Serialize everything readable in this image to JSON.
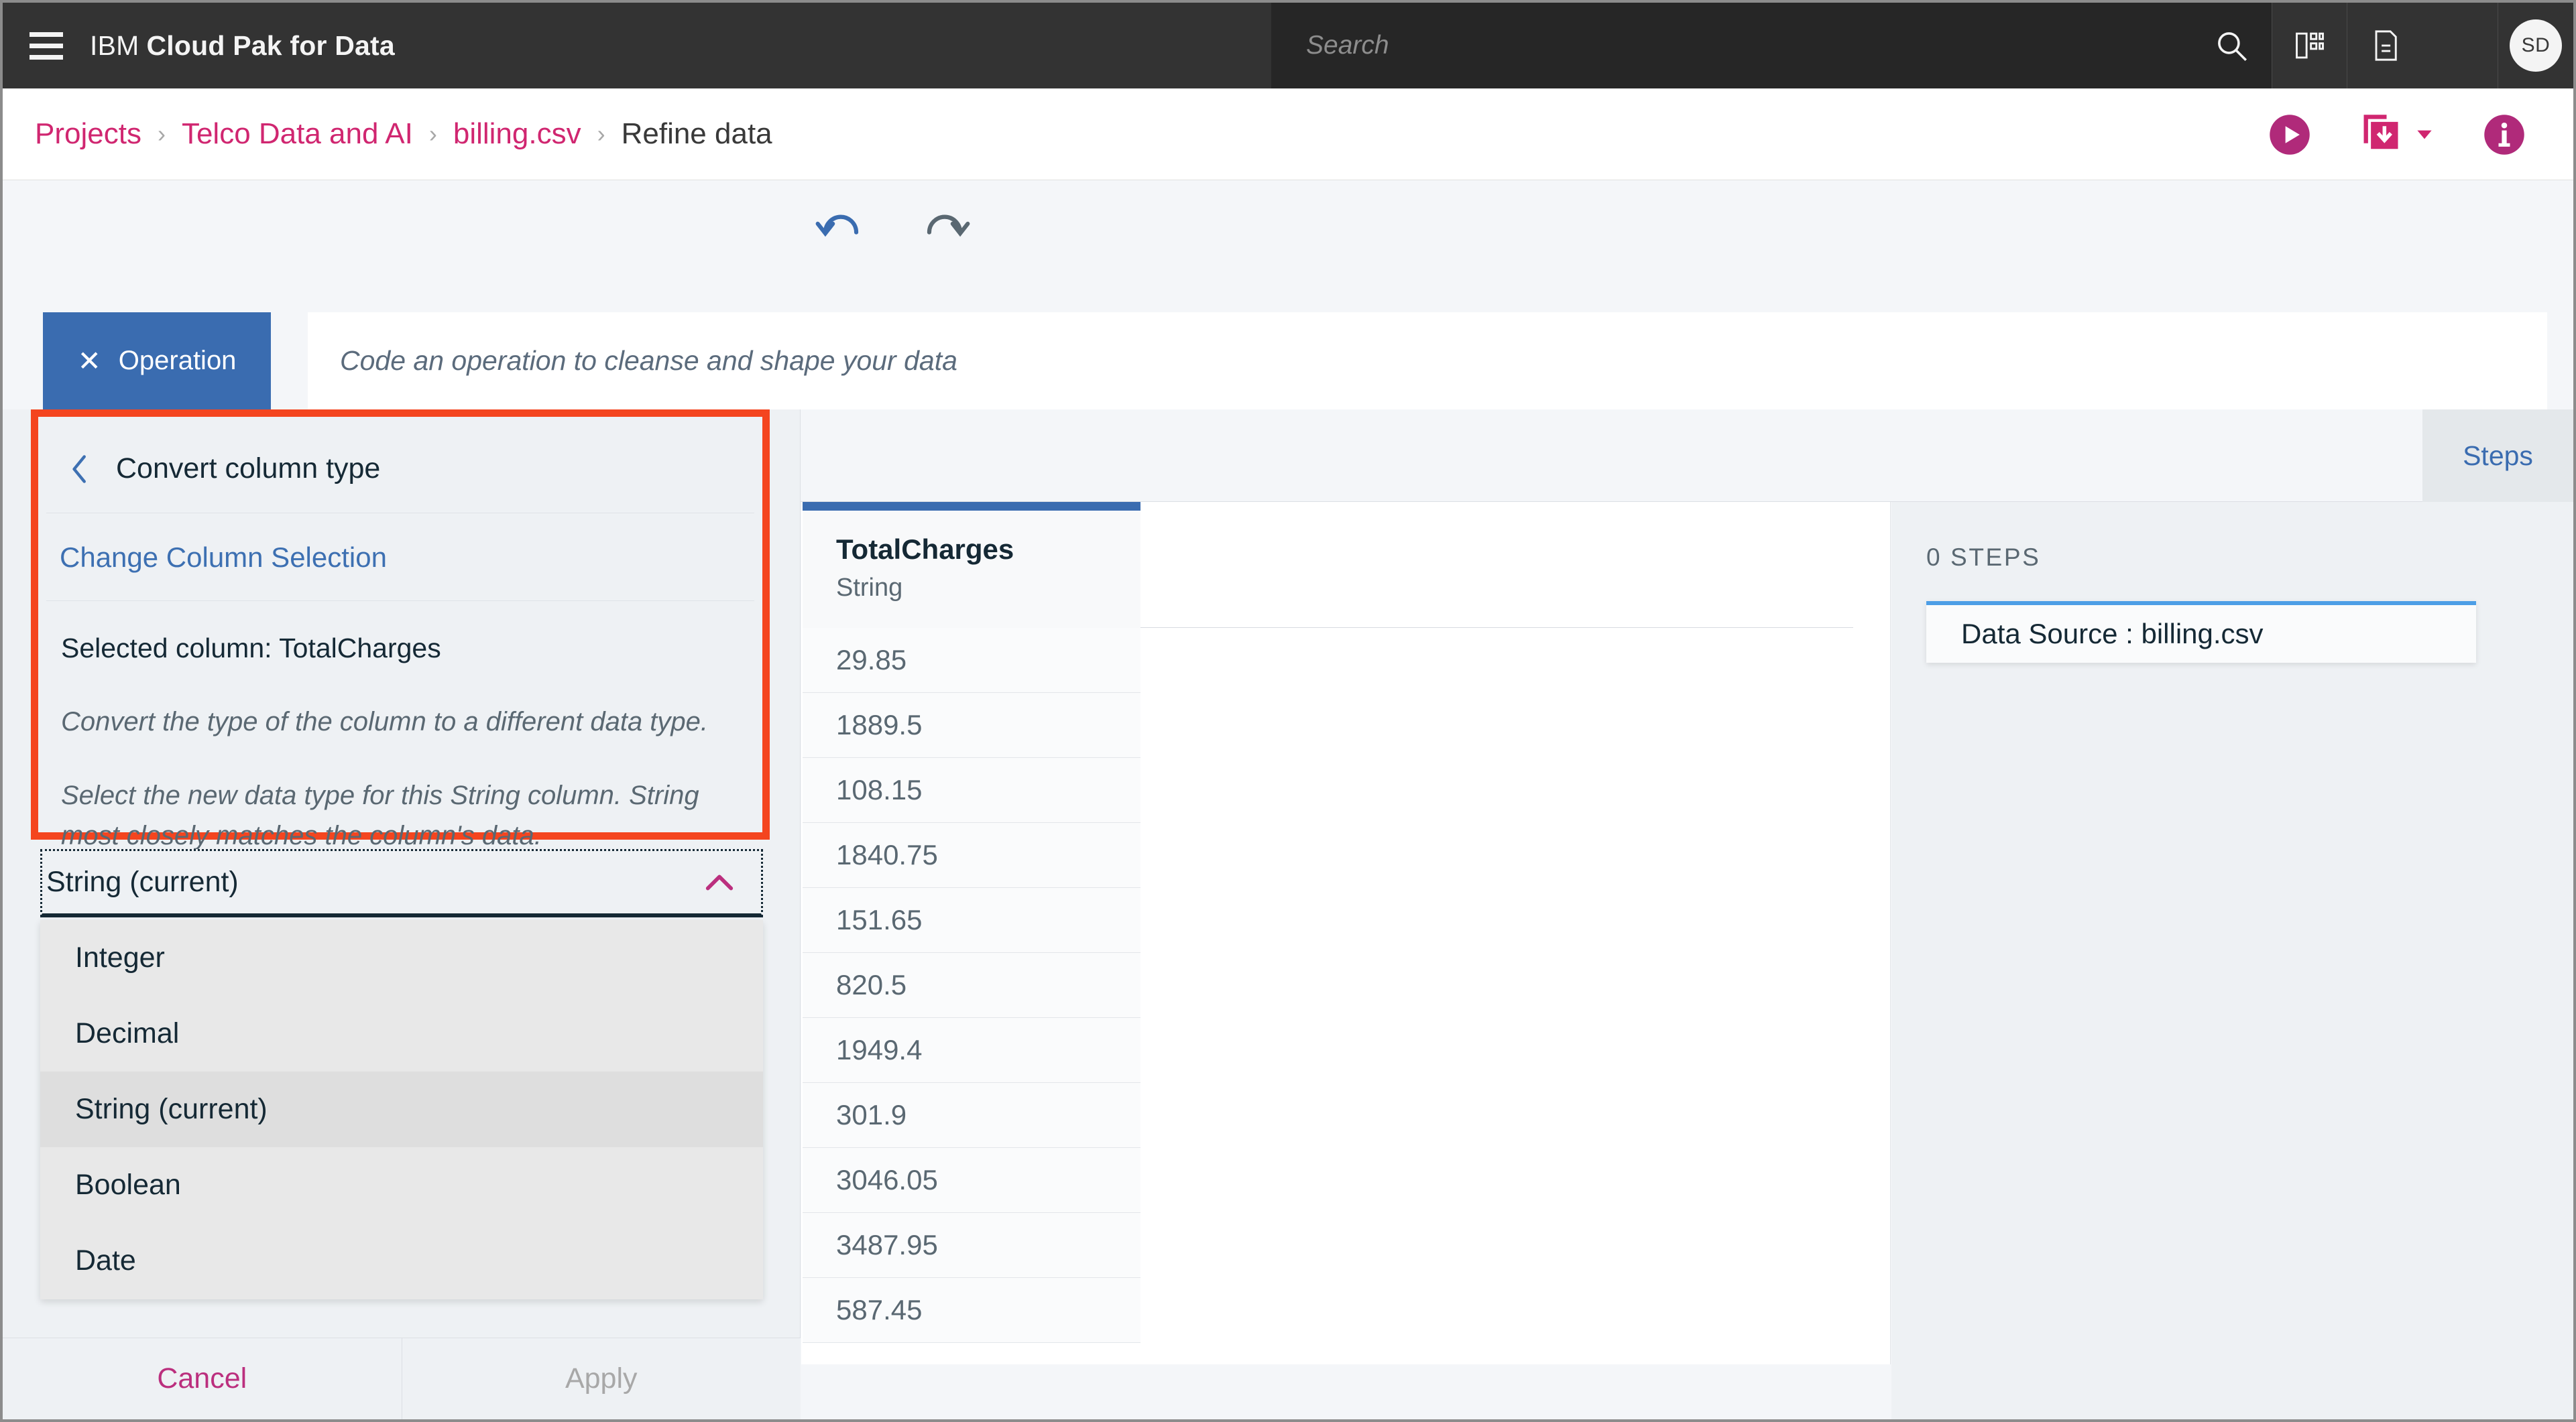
{
  "header": {
    "menu_icon": "hamburger-menu-icon",
    "brand_light": "IBM",
    "brand_bold": "Cloud Pak for Data",
    "search_placeholder": "Search",
    "search_value": "",
    "search_icon": "search-icon",
    "app_switcher_icon": "app-switcher-icon",
    "docs_icon": "document-icon",
    "avatar_initials": "SD"
  },
  "breadcrumb": {
    "items": [
      {
        "label": "Projects",
        "current": false
      },
      {
        "label": "Telco Data and AI",
        "current": false
      },
      {
        "label": "billing.csv",
        "current": false
      },
      {
        "label": "Refine data",
        "current": true
      }
    ],
    "separator": "›",
    "actions": {
      "run_icon": "play-run-icon",
      "save_icon": "save-copy-download-icon",
      "save_caret_icon": "chevron-down-icon",
      "info_icon": "info-icon"
    }
  },
  "operation_bar": {
    "tab_close_icon": "close-x-icon",
    "tab_label": "Operation",
    "code_placeholder": "Code an operation to cleanse and shape your data",
    "code_value": ""
  },
  "toolbar": {
    "undo_icon": "undo-icon",
    "redo_icon": "redo-icon",
    "steps_tab_label": "Steps"
  },
  "operation_panel": {
    "back_icon": "chevron-left-icon",
    "title": "Convert column type",
    "change_column_link": "Change Column Selection",
    "selected_column_label": "Selected column: TotalCharges",
    "description_1": "Convert the type of the column to a different data type.",
    "description_2": "Select the new data type for this String column. String most closely matches the column's data.",
    "select": {
      "value": "String (current)",
      "chevron_icon": "chevron-up-icon",
      "expanded": true,
      "options": [
        {
          "label": "Integer",
          "selected": false
        },
        {
          "label": "Decimal",
          "selected": false
        },
        {
          "label": "String (current)",
          "selected": true
        },
        {
          "label": "Boolean",
          "selected": false
        },
        {
          "label": "Date",
          "selected": false
        }
      ]
    },
    "cancel_label": "Cancel",
    "apply_label": "Apply",
    "highlight_color": "#f4451f"
  },
  "table": {
    "column": {
      "name": "TotalCharges",
      "type": "String",
      "accent_color": "#3a6cb0"
    },
    "rows": [
      "29.85",
      "1889.5",
      "108.15",
      "1840.75",
      "151.65",
      "820.5",
      "1949.4",
      "301.9",
      "3046.05",
      "3487.95",
      "587.45"
    ]
  },
  "steps_panel": {
    "count_label": "0 STEPS",
    "cards": [
      {
        "label": "Data Source : billing.csv"
      }
    ]
  },
  "colors": {
    "header_bg": "#333333",
    "brand_magenta": "#d02670",
    "accent_blue": "#3a6cb0",
    "link_blue": "#3d70b2",
    "highlight_orange": "#f4451f",
    "cancel_magenta": "#bb2f7e"
  }
}
